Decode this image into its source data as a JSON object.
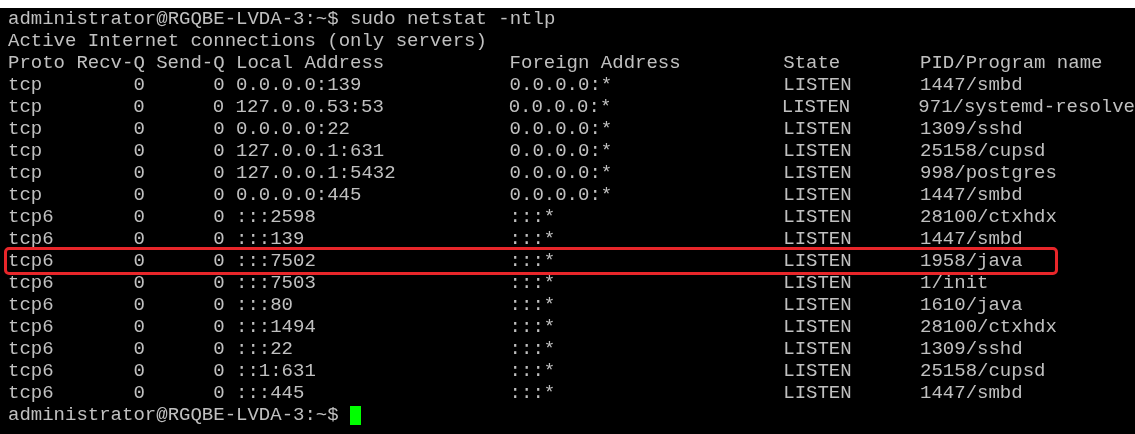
{
  "command_line": {
    "prompt": "administrator@RGQBE-LVDA-3:~$",
    "command": "sudo netstat -ntlp"
  },
  "title_line": "Active Internet connections (only servers)",
  "table": {
    "columns": [
      "Proto",
      "Recv-Q",
      "Send-Q",
      "Local Address",
      "Foreign Address",
      "State",
      "PID/Program name"
    ],
    "rows": [
      {
        "cells": [
          "tcp",
          "0",
          "0",
          "0.0.0.0:139",
          "0.0.0.0:*",
          "LISTEN",
          "1447/smbd"
        ],
        "highlighted": false
      },
      {
        "cells": [
          "tcp",
          "0",
          "0",
          "127.0.0.53:53",
          "0.0.0.0:*",
          "LISTEN",
          "971/systemd-resolve"
        ],
        "highlighted": false
      },
      {
        "cells": [
          "tcp",
          "0",
          "0",
          "0.0.0.0:22",
          "0.0.0.0:*",
          "LISTEN",
          "1309/sshd"
        ],
        "highlighted": false
      },
      {
        "cells": [
          "tcp",
          "0",
          "0",
          "127.0.0.1:631",
          "0.0.0.0:*",
          "LISTEN",
          "25158/cupsd"
        ],
        "highlighted": false
      },
      {
        "cells": [
          "tcp",
          "0",
          "0",
          "127.0.0.1:5432",
          "0.0.0.0:*",
          "LISTEN",
          "998/postgres"
        ],
        "highlighted": false
      },
      {
        "cells": [
          "tcp",
          "0",
          "0",
          "0.0.0.0:445",
          "0.0.0.0:*",
          "LISTEN",
          "1447/smbd"
        ],
        "highlighted": false
      },
      {
        "cells": [
          "tcp6",
          "0",
          "0",
          ":::2598",
          ":::*",
          "LISTEN",
          "28100/ctxhdx"
        ],
        "highlighted": false
      },
      {
        "cells": [
          "tcp6",
          "0",
          "0",
          ":::139",
          ":::*",
          "LISTEN",
          "1447/smbd"
        ],
        "highlighted": false
      },
      {
        "cells": [
          "tcp6",
          "0",
          "0",
          ":::7502",
          ":::*",
          "LISTEN",
          "1958/java"
        ],
        "highlighted": true
      },
      {
        "cells": [
          "tcp6",
          "0",
          "0",
          ":::7503",
          ":::*",
          "LISTEN",
          "1/init"
        ],
        "highlighted": false
      },
      {
        "cells": [
          "tcp6",
          "0",
          "0",
          ":::80",
          ":::*",
          "LISTEN",
          "1610/java"
        ],
        "highlighted": false
      },
      {
        "cells": [
          "tcp6",
          "0",
          "0",
          ":::1494",
          ":::*",
          "LISTEN",
          "28100/ctxhdx"
        ],
        "highlighted": false
      },
      {
        "cells": [
          "tcp6",
          "0",
          "0",
          ":::22",
          ":::*",
          "LISTEN",
          "1309/sshd"
        ],
        "highlighted": false
      },
      {
        "cells": [
          "tcp6",
          "0",
          "0",
          "::1:631",
          ":::*",
          "LISTEN",
          "25158/cupsd"
        ],
        "highlighted": false
      },
      {
        "cells": [
          "tcp6",
          "0",
          "0",
          ":::445",
          ":::*",
          "LISTEN",
          "1447/smbd"
        ],
        "highlighted": false
      }
    ]
  },
  "final_prompt": {
    "prompt": "administrator@RGQBE-LVDA-3:~$",
    "cursor_visible": true
  }
}
